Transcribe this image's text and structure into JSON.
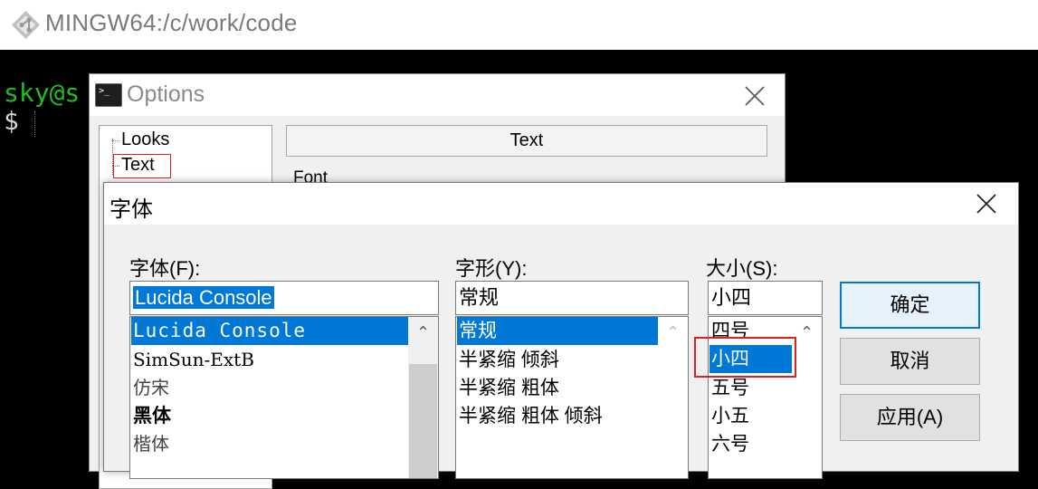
{
  "window": {
    "title": "MINGW64:/c/work/code",
    "icon": "git-diamond-icon"
  },
  "terminal": {
    "line1": "sky@s",
    "line2": "$"
  },
  "options_dialog": {
    "title": "Options",
    "tree": [
      "Looks",
      "Text"
    ],
    "selected_tree_item": "Text",
    "section_header": "Text",
    "font_label": "Font"
  },
  "font_dialog": {
    "title": "字体",
    "font": {
      "label": "字体(F):",
      "value": "Lucida Console",
      "items": [
        "Lucida Console",
        "SimSun-ExtB",
        "仿宋",
        "黑体",
        "楷体"
      ],
      "selected": "Lucida Console"
    },
    "style": {
      "label": "字形(Y):",
      "value": "常规",
      "items": [
        "常规",
        "半紧缩 倾斜",
        "半紧缩 粗体",
        "半紧缩 粗体 倾斜"
      ],
      "selected": "常规"
    },
    "size": {
      "label": "大小(S):",
      "value": "小四",
      "items": [
        "四号",
        "小四",
        "五号",
        "小五",
        "六号"
      ],
      "selected": "小四"
    },
    "buttons": {
      "ok": "确定",
      "cancel": "取消",
      "apply": "应用(A)"
    }
  },
  "colors": {
    "terminal_user": "#1fbb1f",
    "selection": "#0078d7",
    "highlight_box": "#e02020"
  }
}
